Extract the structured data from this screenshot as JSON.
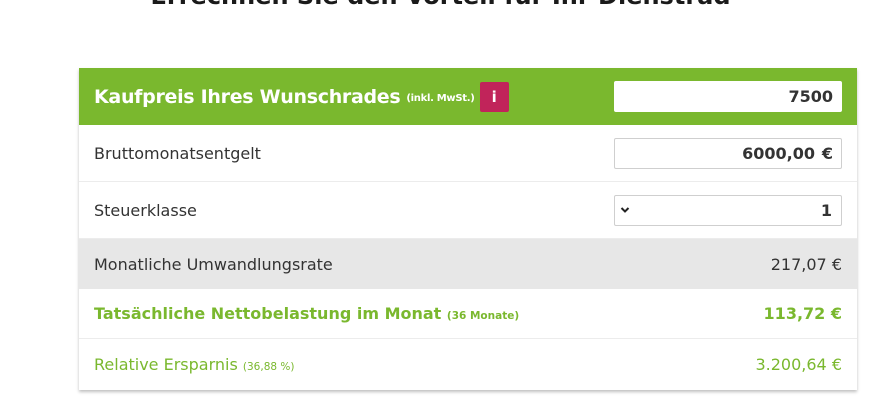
{
  "page": {
    "heading": "Errechnen Sie den Vorteil für Ihr Dienstrad"
  },
  "calculator": {
    "colors": {
      "accent": "#7ab82e",
      "info": "#c1245a",
      "highlight_row": "#e7e7e7"
    },
    "purchase_price": {
      "label": "Kaufpreis Ihres Wunschrades",
      "note": "(inkl. MwSt.)",
      "info_icon": "i",
      "value": "7500"
    },
    "gross_salary": {
      "label": "Bruttomonatsentgelt",
      "value": "6000,00",
      "unit": "€"
    },
    "tax_class": {
      "label": "Steuerklasse",
      "selected": "1",
      "icon": "chevron-down-icon"
    },
    "conversion_rate": {
      "label": "Monatliche Umwandlungsrate",
      "value": "217,07 €"
    },
    "net_burden": {
      "label": "Tatsächliche Nettobelastung im Monat",
      "note": "(36 Monate)",
      "value": "113,72 €"
    },
    "savings": {
      "label": "Relative Ersparnis",
      "note": "(36,88 %)",
      "value": "3.200,64 €"
    }
  }
}
